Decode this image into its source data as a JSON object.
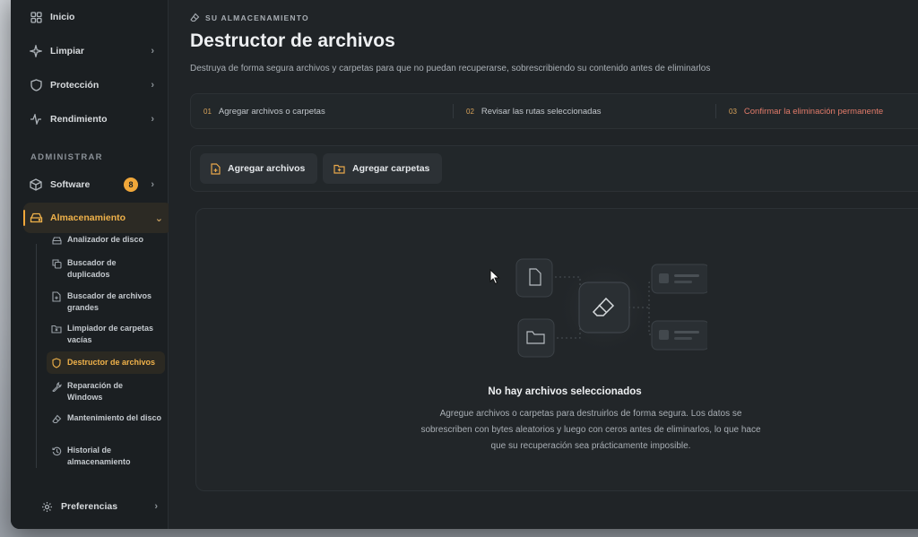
{
  "sidebar": {
    "items": [
      {
        "label": "Inicio",
        "icon": "grid-icon"
      },
      {
        "label": "Limpiar",
        "icon": "sparkle-icon"
      },
      {
        "label": "Protección",
        "icon": "shield-icon"
      },
      {
        "label": "Rendimiento",
        "icon": "pulse-icon"
      }
    ],
    "section_label": "ADMINISTRAR",
    "software": {
      "label": "Software",
      "badge": "8"
    },
    "storage": {
      "label": "Almacenamiento"
    },
    "sub_items": [
      {
        "label": "Analizador de disco"
      },
      {
        "label": "Buscador de duplicados"
      },
      {
        "label": "Buscador de archivos grandes"
      },
      {
        "label": "Limpiador de carpetas vacías"
      },
      {
        "label": "Destructor de archivos"
      },
      {
        "label": "Reparación de Windows"
      },
      {
        "label": "Mantenimiento del disco"
      },
      {
        "label": "Historial de almacenamiento"
      }
    ],
    "preferences": {
      "label": "Preferencias"
    }
  },
  "header": {
    "breadcrumb": "SU ALMACENAMIENTO",
    "title": "Destructor de archivos",
    "subtitle": "Destruya de forma segura archivos y carpetas para que no puedan recuperarse, sobrescribiendo su contenido antes de eliminarlos"
  },
  "steps": [
    {
      "num": "01",
      "label": "Agregar archivos o carpetas"
    },
    {
      "num": "02",
      "label": "Revisar las rutas seleccionadas"
    },
    {
      "num": "03",
      "label": "Confirmar la eliminación permanente"
    }
  ],
  "actions": {
    "add_files": "Agregar archivos",
    "add_folders": "Agregar carpetas"
  },
  "empty_state": {
    "title": "No hay archivos seleccionados",
    "text": "Agregue archivos o carpetas para destruirlos de forma segura. Los datos se sobrescriben con bytes aleatorios y luego con ceros antes de eliminarlos, lo que hace que su recuperación sea prácticamente imposible."
  },
  "colors": {
    "accent": "#f0a73a",
    "danger_step": "#e27b6a",
    "background": "#202427"
  }
}
